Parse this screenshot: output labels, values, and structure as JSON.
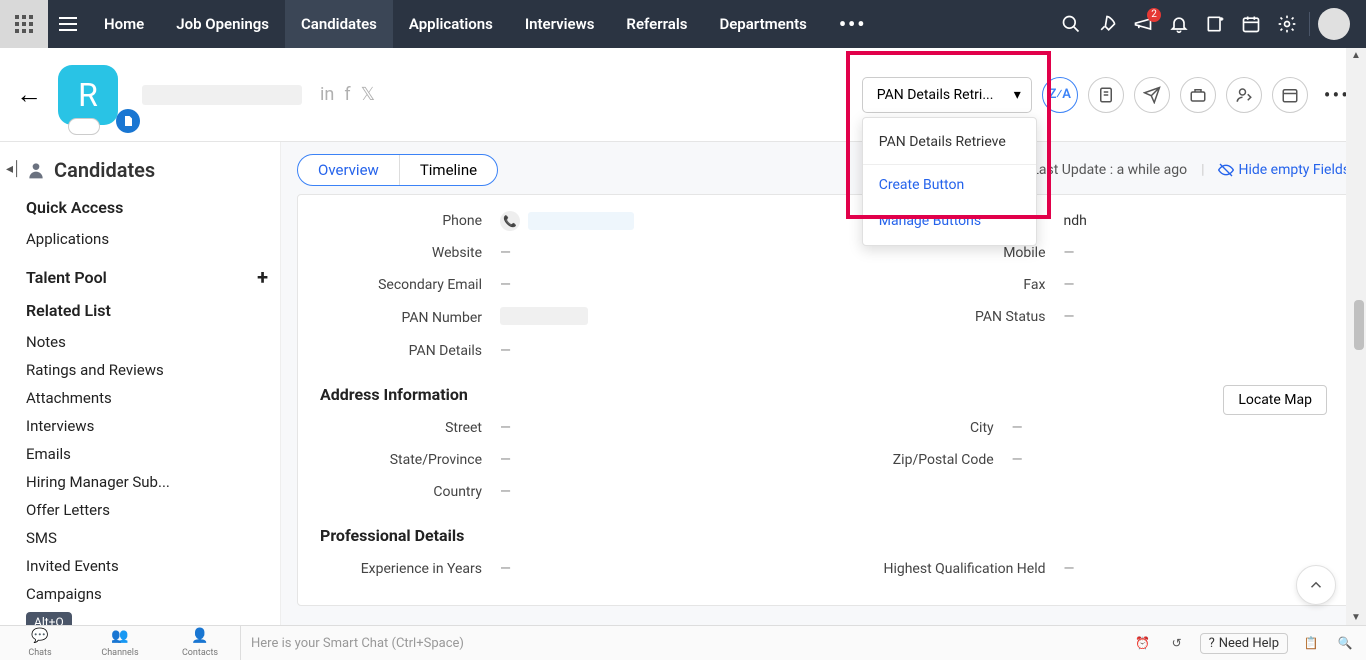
{
  "nav": {
    "tabs": [
      "Home",
      "Job Openings",
      "Candidates",
      "Applications",
      "Interviews",
      "Referrals",
      "Departments"
    ],
    "active": "Candidates",
    "notif_badge": "2"
  },
  "candidate": {
    "initial": "R",
    "rating_text": "--"
  },
  "dropdown": {
    "button_label": "PAN Details Retri...",
    "items": [
      "PAN Details Retrieve",
      "Create Button",
      "Manage Buttons"
    ]
  },
  "sidebar": {
    "title": "Candidates",
    "quick_access": "Quick Access",
    "quick_items": [
      "Applications"
    ],
    "talent_pool": "Talent Pool",
    "related_list": "Related List",
    "related_items": [
      "Notes",
      "Ratings and Reviews",
      "Attachments",
      "Interviews",
      "Emails",
      "Hiring Manager Sub...",
      "Offer Letters",
      "SMS",
      "Invited Events",
      "Campaigns"
    ],
    "alt_q": "Alt+Q"
  },
  "tabs": {
    "overview": "Overview",
    "timeline": "Timeline",
    "last_update": "Last Update : a while ago",
    "hide_empty": "Hide empty Fields"
  },
  "fields": {
    "phone": "Phone",
    "website": "Website",
    "secondary_email": "Secondary Email",
    "pan_number": "PAN Number",
    "pan_details": "PAN Details",
    "mobile": "Mobile",
    "fax": "Fax",
    "pan_status": "PAN Status",
    "address_info": "Address Information",
    "locate_map": "Locate Map",
    "street": "Street",
    "city": "City",
    "state": "State/Province",
    "zip": "Zip/Postal Code",
    "country": "Country",
    "prof_details": "Professional Details",
    "experience": "Experience in Years",
    "highest_qual": "Highest Qualification Held",
    "empty": "—",
    "right_top_partial": "ndh"
  },
  "bottom": {
    "chats": "Chats",
    "channels": "Channels",
    "contacts": "Contacts",
    "placeholder": "Here is your Smart Chat (Ctrl+Space)",
    "need_help": "Need Help"
  }
}
